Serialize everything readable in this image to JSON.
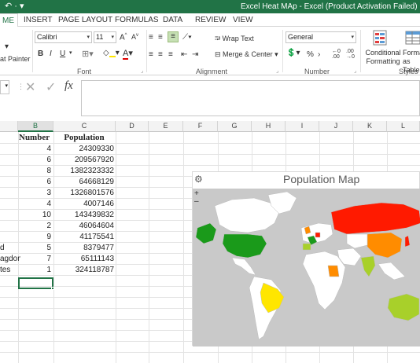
{
  "window": {
    "quick_access": "↶ ·  ▾",
    "title": "Excel Heat MAp - Excel (Product Activation Failed)"
  },
  "tabs": [
    "ME",
    "INSERT",
    "PAGE LAYOUT",
    "FORMULAS",
    "DATA",
    "REVIEW",
    "VIEW"
  ],
  "ribbon": {
    "clipboard": {
      "format_painter": "at Painter"
    },
    "font": {
      "name": "Calibri",
      "size": "11",
      "bold": "B",
      "italic": "I",
      "underline": "U",
      "label": "Font"
    },
    "alignment": {
      "wrap_text": "Wrap Text",
      "merge_center": "Merge & Center",
      "label": "Alignment"
    },
    "number": {
      "format": "General",
      "percent": "%",
      "comma": "›",
      "label": "Number"
    },
    "styles": {
      "conditional_formatting": "Conditional Formatting",
      "format_as_table": "Format as Table",
      "label": "Styles"
    }
  },
  "formula_bar": {
    "fx": "fx",
    "cancel": "✕",
    "enter": "✓",
    "value": ""
  },
  "columns": [
    "B",
    "C",
    "D",
    "E",
    "F",
    "G",
    "H",
    "I",
    "J",
    "K",
    "L"
  ],
  "selected_column": "B",
  "table": {
    "headers": {
      "number": "Number",
      "population": "Population"
    },
    "rows": [
      {
        "a": "",
        "number": "4",
        "population": "24309330"
      },
      {
        "a": "",
        "number": "6",
        "population": "209567920"
      },
      {
        "a": "",
        "number": "8",
        "population": "1382323332"
      },
      {
        "a": "",
        "number": "6",
        "population": "64668129"
      },
      {
        "a": "",
        "number": "3",
        "population": "1326801576"
      },
      {
        "a": "",
        "number": "4",
        "population": "4007146"
      },
      {
        "a": "",
        "number": "10",
        "population": "143439832"
      },
      {
        "a": "",
        "number": "2",
        "population": "46064604"
      },
      {
        "a": "",
        "number": "9",
        "population": "41175541"
      },
      {
        "a": "d",
        "number": "5",
        "population": "8379477"
      },
      {
        "a": "agdom",
        "number": "7",
        "population": "65111143"
      },
      {
        "a": "tes",
        "number": "1",
        "population": "324118787"
      }
    ]
  },
  "chart": {
    "title": "Population Map",
    "zoom_in": "+",
    "zoom_out": "–",
    "colors": {
      "background": "#c9c9c9",
      "land_default": "#ffffff",
      "red": "#ff1a00",
      "orange": "#ff8c00",
      "yellow": "#ffe600",
      "light_green": "#a8d02a",
      "green": "#1a9a1a"
    }
  }
}
